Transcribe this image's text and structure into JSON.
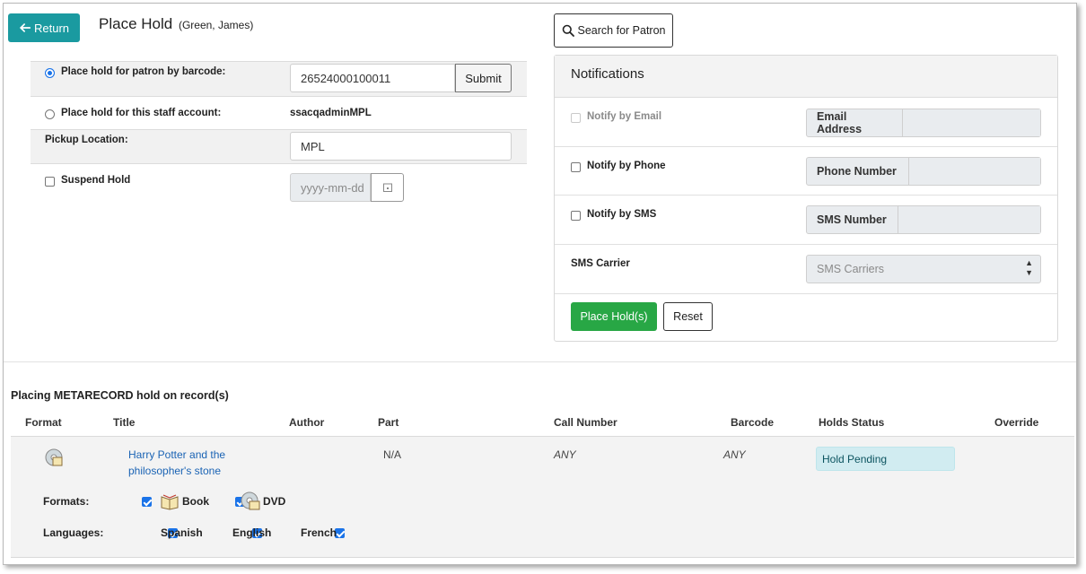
{
  "header": {
    "return_label": "Return",
    "title": "Place Hold",
    "patron_name": "(Green, James)"
  },
  "form": {
    "barcode_label": "Place hold for patron by barcode:",
    "barcode_value": "26524000100011",
    "submit_label": "Submit",
    "staff_label": "Place hold for this staff account:",
    "staff_value": "ssacqadminMPL",
    "pickup_label": "Pickup Location:",
    "pickup_value": "MPL",
    "suspend_label": "Suspend Hold",
    "date_placeholder": "yyyy-mm-dd"
  },
  "search_patron_label": "Search for Patron",
  "notifications": {
    "title": "Notifications",
    "email_label": "Notify by Email",
    "email_field": "Email Address",
    "phone_label": "Notify by Phone",
    "phone_field": "Phone Number",
    "sms_label": "Notify by SMS",
    "sms_field": "SMS Number",
    "carrier_label": "SMS Carrier",
    "carrier_placeholder": "SMS Carriers",
    "place_label": "Place Hold(s)",
    "reset_label": "Reset"
  },
  "records": {
    "section_title": "Placing METARECORD hold on record(s)",
    "headers": {
      "format": "Format",
      "title": "Title",
      "author": "Author",
      "part": "Part",
      "call_number": "Call Number",
      "barcode": "Barcode",
      "holds_status": "Holds Status",
      "override": "Override"
    },
    "row": {
      "title_line1": "Harry Potter and the",
      "title_line2": "philosopher's stone",
      "part": "N/A",
      "call_number": "ANY",
      "barcode": "ANY",
      "status": "Hold Pending"
    },
    "formats_label": "Formats:",
    "formats": [
      "Book",
      "DVD"
    ],
    "languages_label": "Languages:",
    "languages": [
      "Spanish",
      "English",
      "French"
    ]
  },
  "colors": {
    "return_button": "#1a9aa0",
    "place_button": "#28a745",
    "status_badge": "#d1ecf1",
    "checkbox_blue": "#1a73e8"
  }
}
